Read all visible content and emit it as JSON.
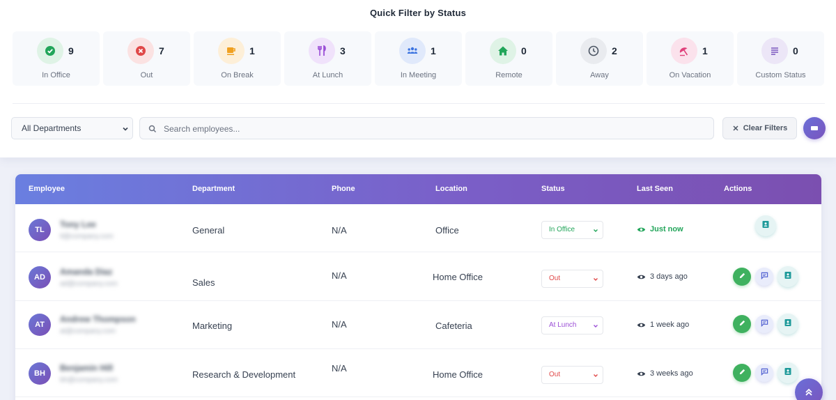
{
  "quick_filter": {
    "title": "Quick Filter by Status",
    "cards": [
      {
        "label": "In Office",
        "count": "9",
        "icon": "check-circle-icon",
        "color": "#22a55a",
        "bg": "#dff3e6"
      },
      {
        "label": "Out",
        "count": "7",
        "icon": "x-circle-icon",
        "color": "#e04848",
        "bg": "#fbe2e2"
      },
      {
        "label": "On Break",
        "count": "1",
        "icon": "coffee-icon",
        "color": "#f0a020",
        "bg": "#fdefd8"
      },
      {
        "label": "At Lunch",
        "count": "3",
        "icon": "utensils-icon",
        "color": "#9b4fd6",
        "bg": "#f0e2fb"
      },
      {
        "label": "In Meeting",
        "count": "1",
        "icon": "users-icon",
        "color": "#3b73e0",
        "bg": "#e0e9fb"
      },
      {
        "label": "Remote",
        "count": "0",
        "icon": "home-icon",
        "color": "#22a55a",
        "bg": "#dff3e6"
      },
      {
        "label": "Away",
        "count": "2",
        "icon": "clock-icon",
        "color": "#4b5563",
        "bg": "#e9ebef"
      },
      {
        "label": "On Vacation",
        "count": "1",
        "icon": "umbrella-icon",
        "color": "#e0407a",
        "bg": "#fbe2ec"
      },
      {
        "label": "Custom Status",
        "count": "0",
        "icon": "lines-icon",
        "color": "#7a55be",
        "bg": "#ece6f7"
      }
    ]
  },
  "filters": {
    "department": "All Departments",
    "search_placeholder": "Search employees...",
    "clear_label": "Clear Filters"
  },
  "table": {
    "headers": [
      "Employee",
      "Department",
      "Phone",
      "Location",
      "Status",
      "Last Seen",
      "Actions"
    ],
    "rows": [
      {
        "initials": "TL",
        "name": "Tony Lee",
        "email": "tl@company.com",
        "department": "General",
        "phone": "N/A",
        "location": "Office",
        "status": "In Office",
        "status_color": "#22a55a",
        "last_seen": "Just now",
        "last_seen_color": "#22a55a"
      },
      {
        "initials": "AD",
        "name": "Amanda Diaz",
        "email": "ad@company.com",
        "department": "Sales",
        "phone": "N/A",
        "location": "Home Office",
        "status": "Out",
        "status_color": "#e04848",
        "last_seen": "3 days ago",
        "last_seen_color": "#374151"
      },
      {
        "initials": "AT",
        "name": "Andrew Thompson",
        "email": "at@company.com",
        "department": "Marketing",
        "phone": "N/A",
        "location": "Cafeteria",
        "status": "At Lunch",
        "status_color": "#9b4fd6",
        "last_seen": "1 week ago",
        "last_seen_color": "#374151"
      },
      {
        "initials": "BH",
        "name": "Benjamin Hill",
        "email": "bh@company.com",
        "department": "Research & Development",
        "phone": "N/A",
        "location": "Home Office",
        "status": "Out",
        "status_color": "#e04848",
        "last_seen": "3 weeks ago",
        "last_seen_color": "#374151"
      }
    ]
  }
}
